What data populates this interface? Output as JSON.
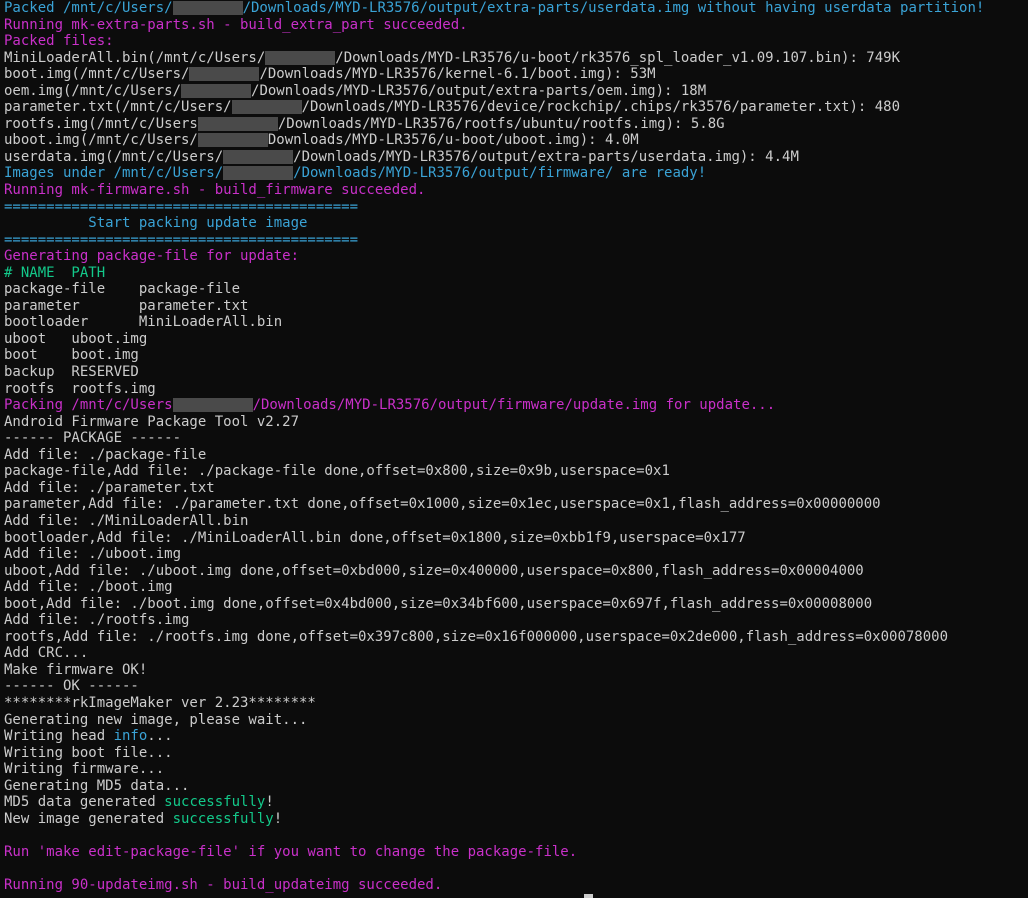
{
  "terminal": {
    "lines": [
      {
        "segments": [
          {
            "t": "Packed /mnt/c/Users/",
            "c": "c"
          },
          {
            "mask": 70
          },
          {
            "t": "/Downloads/MYD-LR3576/output/extra-parts/userdata.img without having userdata partition!",
            "c": "c"
          }
        ]
      },
      {
        "segments": [
          {
            "t": "Running mk-extra-parts.sh - build_extra_part succeeded.",
            "c": "p"
          }
        ]
      },
      {
        "segments": [
          {
            "t": "Packed files:",
            "c": "p"
          }
        ]
      },
      {
        "segments": [
          {
            "t": "MiniLoaderAll.bin(/mnt/c/Users/",
            "c": "w"
          },
          {
            "mask": 70
          },
          {
            "t": "/Downloads/MYD-LR3576/u-boot/rk3576_spl_loader_v1.09.107.bin): 749K",
            "c": "w"
          }
        ]
      },
      {
        "segments": [
          {
            "t": "boot.img(/mnt/c/Users/",
            "c": "w"
          },
          {
            "mask": 70
          },
          {
            "t": "/Downloads/MYD-LR3576/kernel-6.1/boot.img): 53M",
            "c": "w"
          }
        ]
      },
      {
        "segments": [
          {
            "t": "oem.img(/mnt/c/Users/",
            "c": "w"
          },
          {
            "mask": 70
          },
          {
            "t": "/Downloads/MYD-LR3576/output/extra-parts/oem.img): 18M",
            "c": "w"
          }
        ]
      },
      {
        "segments": [
          {
            "t": "parameter.txt(/mnt/c/Users/",
            "c": "w"
          },
          {
            "mask": 70
          },
          {
            "t": "/Downloads/MYD-LR3576/device/rockchip/.chips/rk3576/parameter.txt): 480",
            "c": "w"
          }
        ]
      },
      {
        "segments": [
          {
            "t": "rootfs.img(/mnt/c/Users",
            "c": "w"
          },
          {
            "mask": 80
          },
          {
            "t": "/Downloads/MYD-LR3576/rootfs/ubuntu/rootfs.img): 5.8G",
            "c": "w"
          }
        ]
      },
      {
        "segments": [
          {
            "t": "uboot.img(/mnt/c/Users/",
            "c": "w"
          },
          {
            "mask": 70
          },
          {
            "t": "Downloads/MYD-LR3576/u-boot/uboot.img): 4.0M",
            "c": "w"
          }
        ]
      },
      {
        "segments": [
          {
            "t": "userdata.img(/mnt/c/Users/",
            "c": "w"
          },
          {
            "mask": 70
          },
          {
            "t": "/Downloads/MYD-LR3576/output/extra-parts/userdata.img): 4.4M",
            "c": "w"
          }
        ]
      },
      {
        "segments": [
          {
            "t": "Images under /mnt/c/Users/",
            "c": "c"
          },
          {
            "mask": 70
          },
          {
            "t": "/Downloads/MYD-LR3576/output/firmware/ are ready!",
            "c": "c"
          }
        ]
      },
      {
        "segments": [
          {
            "t": "Running mk-firmware.sh - build_firmware succeeded.",
            "c": "p"
          }
        ]
      },
      {
        "segments": [
          {
            "t": "==========================================",
            "c": "c"
          }
        ]
      },
      {
        "segments": [
          {
            "t": "          Start packing update image",
            "c": "c"
          }
        ]
      },
      {
        "segments": [
          {
            "t": "==========================================",
            "c": "c"
          }
        ]
      },
      {
        "segments": [
          {
            "t": "Generating package-file for update:",
            "c": "p"
          }
        ]
      },
      {
        "segments": [
          {
            "t": "# NAME  PATH",
            "c": "g"
          }
        ]
      },
      {
        "segments": [
          {
            "t": "package-file    package-file",
            "c": "w"
          }
        ]
      },
      {
        "segments": [
          {
            "t": "parameter       parameter.txt",
            "c": "w"
          }
        ]
      },
      {
        "segments": [
          {
            "t": "bootloader      MiniLoaderAll.bin",
            "c": "w"
          }
        ]
      },
      {
        "segments": [
          {
            "t": "uboot   uboot.img",
            "c": "w"
          }
        ]
      },
      {
        "segments": [
          {
            "t": "boot    boot.img",
            "c": "w"
          }
        ]
      },
      {
        "segments": [
          {
            "t": "backup  RESERVED",
            "c": "w"
          }
        ]
      },
      {
        "segments": [
          {
            "t": "rootfs  rootfs.img",
            "c": "w"
          }
        ]
      },
      {
        "segments": [
          {
            "t": "Packing /mnt/c/Users",
            "c": "p"
          },
          {
            "mask": 80
          },
          {
            "t": "/Downloads/MYD-LR3576/output/firmware/update.img for update...",
            "c": "p"
          }
        ]
      },
      {
        "segments": [
          {
            "t": "Android Firmware Package Tool v2.27",
            "c": "w"
          }
        ]
      },
      {
        "segments": [
          {
            "t": "------ PACKAGE ------",
            "c": "w"
          }
        ]
      },
      {
        "segments": [
          {
            "t": "Add file: ./package-file",
            "c": "w"
          }
        ]
      },
      {
        "segments": [
          {
            "t": "package-file,Add file: ./package-file done,offset=0x800,size=0x9b,userspace=0x1",
            "c": "w"
          }
        ]
      },
      {
        "segments": [
          {
            "t": "Add file: ./parameter.txt",
            "c": "w"
          }
        ]
      },
      {
        "segments": [
          {
            "t": "parameter,Add file: ./parameter.txt done,offset=0x1000,size=0x1ec,userspace=0x1,flash_address=0x00000000",
            "c": "w"
          }
        ]
      },
      {
        "segments": [
          {
            "t": "Add file: ./MiniLoaderAll.bin",
            "c": "w"
          }
        ]
      },
      {
        "segments": [
          {
            "t": "bootloader,Add file: ./MiniLoaderAll.bin done,offset=0x1800,size=0xbb1f9,userspace=0x177",
            "c": "w"
          }
        ]
      },
      {
        "segments": [
          {
            "t": "Add file: ./uboot.img",
            "c": "w"
          }
        ]
      },
      {
        "segments": [
          {
            "t": "uboot,Add file: ./uboot.img done,offset=0xbd000,size=0x400000,userspace=0x800,flash_address=0x00004000",
            "c": "w"
          }
        ]
      },
      {
        "segments": [
          {
            "t": "Add file: ./boot.img",
            "c": "w"
          }
        ]
      },
      {
        "segments": [
          {
            "t": "boot,Add file: ./boot.img done,offset=0x4bd000,size=0x34bf600,userspace=0x697f,flash_address=0x00008000",
            "c": "w"
          }
        ]
      },
      {
        "segments": [
          {
            "t": "Add file: ./rootfs.img",
            "c": "w"
          }
        ]
      },
      {
        "segments": [
          {
            "t": "rootfs,Add file: ./rootfs.img done,offset=0x397c800,size=0x16f000000,userspace=0x2de000,flash_address=0x00078000",
            "c": "w"
          }
        ]
      },
      {
        "segments": [
          {
            "t": "Add CRC...",
            "c": "w"
          }
        ]
      },
      {
        "segments": [
          {
            "t": "Make firmware OK!",
            "c": "w"
          }
        ]
      },
      {
        "segments": [
          {
            "t": "------ OK ------",
            "c": "w"
          }
        ]
      },
      {
        "segments": [
          {
            "t": "********rkImageMaker ver 2.23********",
            "c": "w"
          }
        ]
      },
      {
        "segments": [
          {
            "t": "Generating new image, please wait...",
            "c": "w"
          }
        ]
      },
      {
        "segments": [
          {
            "t": "Writing head ",
            "c": "w"
          },
          {
            "t": "info",
            "c": "c"
          },
          {
            "t": "...",
            "c": "w"
          }
        ]
      },
      {
        "segments": [
          {
            "t": "Writing boot file...",
            "c": "w"
          }
        ]
      },
      {
        "segments": [
          {
            "t": "Writing firmware...",
            "c": "w"
          }
        ]
      },
      {
        "segments": [
          {
            "t": "Generating MD5 data...",
            "c": "w"
          }
        ]
      },
      {
        "segments": [
          {
            "t": "MD5 data generated ",
            "c": "w"
          },
          {
            "t": "successfully",
            "c": "g"
          },
          {
            "t": "!",
            "c": "w"
          }
        ]
      },
      {
        "segments": [
          {
            "t": "New image generated ",
            "c": "w"
          },
          {
            "t": "successfully",
            "c": "g"
          },
          {
            "t": "!",
            "c": "w"
          }
        ]
      },
      {
        "segments": []
      },
      {
        "segments": [
          {
            "t": "Run 'make edit-package-file' if you want to change the package-file.",
            "c": "p"
          }
        ]
      },
      {
        "segments": []
      },
      {
        "segments": [
          {
            "t": "Running 90-updateimg.sh - build_updateimg succeeded.",
            "c": "p"
          }
        ]
      }
    ]
  },
  "colors": {
    "background": "#0c0c0c",
    "text": "#cccccc",
    "magenta": "#c930c9",
    "cyan": "#3aa3d6",
    "green": "#13c98a"
  },
  "icons": {
    "cursor": "block-cursor"
  }
}
